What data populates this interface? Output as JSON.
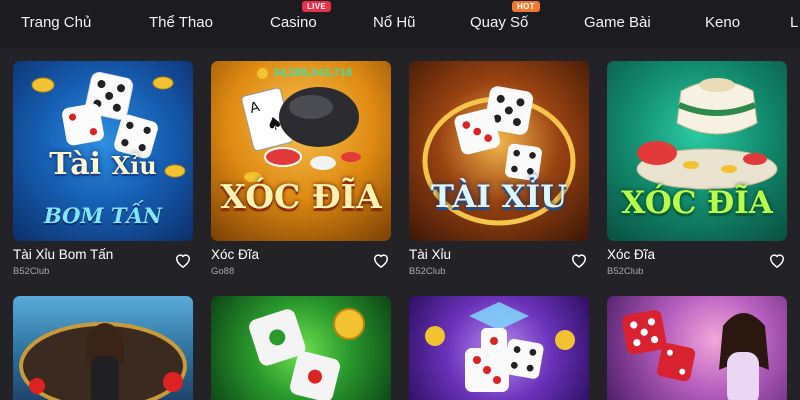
{
  "nav": {
    "items": [
      "Trang Chủ",
      "Thể Thao",
      "Casino",
      "Nổ Hũ",
      "Quay Số",
      "Game Bài",
      "Keno",
      "L"
    ],
    "badges": {
      "casino": "LIVE",
      "quay_so": "HOT"
    }
  },
  "jackpot": "34,285,043,718",
  "art": {
    "c1_line1": "Tài",
    "c1_line2": "Xỉu",
    "c1_line3": "BOM TẤN",
    "c2": "XÓC ĐĨA",
    "c3": "TÀI XỈU",
    "c4": "XÓC ĐĨA"
  },
  "cards": [
    {
      "title": "Tài Xỉu Bom Tấn",
      "provider": "B52Club"
    },
    {
      "title": "Xóc Đĩa",
      "provider": "Go88"
    },
    {
      "title": "Tài Xỉu",
      "provider": "B52Club"
    },
    {
      "title": "Xóc Đĩa",
      "provider": "B52Club"
    }
  ],
  "colors": {
    "background": "#232327",
    "nav_bg": "#1c1c20",
    "live_badge": "#e8304a",
    "hot_badge": "#ef7a2f",
    "jackpot_text": "#3fe0a6"
  },
  "icons": [
    "heart-outline-icon",
    "coin-icon",
    "dice-icon",
    "poker-chip-icon"
  ]
}
